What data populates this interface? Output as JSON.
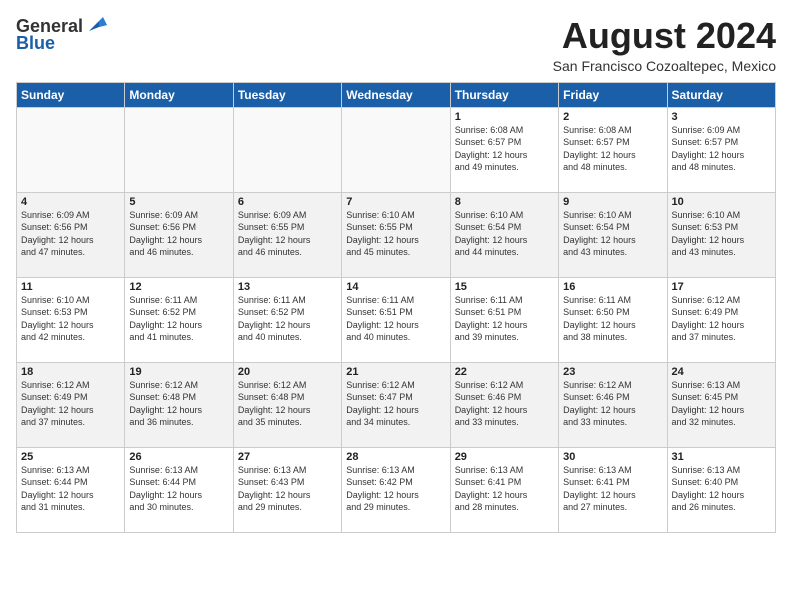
{
  "header": {
    "logo_general": "General",
    "logo_blue": "Blue",
    "title": "August 2024",
    "subtitle": "San Francisco Cozoaltepec, Mexico"
  },
  "weekdays": [
    "Sunday",
    "Monday",
    "Tuesday",
    "Wednesday",
    "Thursday",
    "Friday",
    "Saturday"
  ],
  "weeks": [
    [
      {
        "day": "",
        "info": ""
      },
      {
        "day": "",
        "info": ""
      },
      {
        "day": "",
        "info": ""
      },
      {
        "day": "",
        "info": ""
      },
      {
        "day": "1",
        "info": "Sunrise: 6:08 AM\nSunset: 6:57 PM\nDaylight: 12 hours\nand 49 minutes."
      },
      {
        "day": "2",
        "info": "Sunrise: 6:08 AM\nSunset: 6:57 PM\nDaylight: 12 hours\nand 48 minutes."
      },
      {
        "day": "3",
        "info": "Sunrise: 6:09 AM\nSunset: 6:57 PM\nDaylight: 12 hours\nand 48 minutes."
      }
    ],
    [
      {
        "day": "4",
        "info": "Sunrise: 6:09 AM\nSunset: 6:56 PM\nDaylight: 12 hours\nand 47 minutes."
      },
      {
        "day": "5",
        "info": "Sunrise: 6:09 AM\nSunset: 6:56 PM\nDaylight: 12 hours\nand 46 minutes."
      },
      {
        "day": "6",
        "info": "Sunrise: 6:09 AM\nSunset: 6:55 PM\nDaylight: 12 hours\nand 46 minutes."
      },
      {
        "day": "7",
        "info": "Sunrise: 6:10 AM\nSunset: 6:55 PM\nDaylight: 12 hours\nand 45 minutes."
      },
      {
        "day": "8",
        "info": "Sunrise: 6:10 AM\nSunset: 6:54 PM\nDaylight: 12 hours\nand 44 minutes."
      },
      {
        "day": "9",
        "info": "Sunrise: 6:10 AM\nSunset: 6:54 PM\nDaylight: 12 hours\nand 43 minutes."
      },
      {
        "day": "10",
        "info": "Sunrise: 6:10 AM\nSunset: 6:53 PM\nDaylight: 12 hours\nand 43 minutes."
      }
    ],
    [
      {
        "day": "11",
        "info": "Sunrise: 6:10 AM\nSunset: 6:53 PM\nDaylight: 12 hours\nand 42 minutes."
      },
      {
        "day": "12",
        "info": "Sunrise: 6:11 AM\nSunset: 6:52 PM\nDaylight: 12 hours\nand 41 minutes."
      },
      {
        "day": "13",
        "info": "Sunrise: 6:11 AM\nSunset: 6:52 PM\nDaylight: 12 hours\nand 40 minutes."
      },
      {
        "day": "14",
        "info": "Sunrise: 6:11 AM\nSunset: 6:51 PM\nDaylight: 12 hours\nand 40 minutes."
      },
      {
        "day": "15",
        "info": "Sunrise: 6:11 AM\nSunset: 6:51 PM\nDaylight: 12 hours\nand 39 minutes."
      },
      {
        "day": "16",
        "info": "Sunrise: 6:11 AM\nSunset: 6:50 PM\nDaylight: 12 hours\nand 38 minutes."
      },
      {
        "day": "17",
        "info": "Sunrise: 6:12 AM\nSunset: 6:49 PM\nDaylight: 12 hours\nand 37 minutes."
      }
    ],
    [
      {
        "day": "18",
        "info": "Sunrise: 6:12 AM\nSunset: 6:49 PM\nDaylight: 12 hours\nand 37 minutes."
      },
      {
        "day": "19",
        "info": "Sunrise: 6:12 AM\nSunset: 6:48 PM\nDaylight: 12 hours\nand 36 minutes."
      },
      {
        "day": "20",
        "info": "Sunrise: 6:12 AM\nSunset: 6:48 PM\nDaylight: 12 hours\nand 35 minutes."
      },
      {
        "day": "21",
        "info": "Sunrise: 6:12 AM\nSunset: 6:47 PM\nDaylight: 12 hours\nand 34 minutes."
      },
      {
        "day": "22",
        "info": "Sunrise: 6:12 AM\nSunset: 6:46 PM\nDaylight: 12 hours\nand 33 minutes."
      },
      {
        "day": "23",
        "info": "Sunrise: 6:12 AM\nSunset: 6:46 PM\nDaylight: 12 hours\nand 33 minutes."
      },
      {
        "day": "24",
        "info": "Sunrise: 6:13 AM\nSunset: 6:45 PM\nDaylight: 12 hours\nand 32 minutes."
      }
    ],
    [
      {
        "day": "25",
        "info": "Sunrise: 6:13 AM\nSunset: 6:44 PM\nDaylight: 12 hours\nand 31 minutes."
      },
      {
        "day": "26",
        "info": "Sunrise: 6:13 AM\nSunset: 6:44 PM\nDaylight: 12 hours\nand 30 minutes."
      },
      {
        "day": "27",
        "info": "Sunrise: 6:13 AM\nSunset: 6:43 PM\nDaylight: 12 hours\nand 29 minutes."
      },
      {
        "day": "28",
        "info": "Sunrise: 6:13 AM\nSunset: 6:42 PM\nDaylight: 12 hours\nand 29 minutes."
      },
      {
        "day": "29",
        "info": "Sunrise: 6:13 AM\nSunset: 6:41 PM\nDaylight: 12 hours\nand 28 minutes."
      },
      {
        "day": "30",
        "info": "Sunrise: 6:13 AM\nSunset: 6:41 PM\nDaylight: 12 hours\nand 27 minutes."
      },
      {
        "day": "31",
        "info": "Sunrise: 6:13 AM\nSunset: 6:40 PM\nDaylight: 12 hours\nand 26 minutes."
      }
    ]
  ]
}
